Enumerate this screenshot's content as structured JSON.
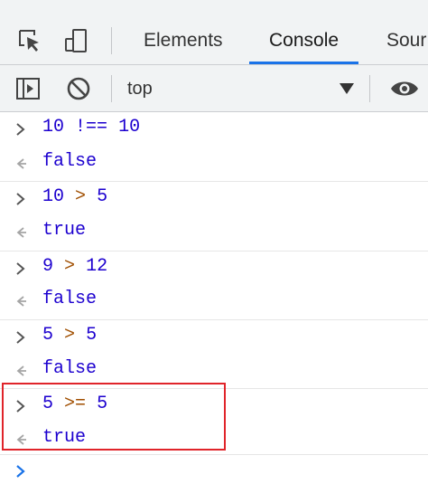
{
  "tabs": [
    {
      "label": "Elements",
      "active": false
    },
    {
      "label": "Console",
      "active": true
    },
    {
      "label": "Sour",
      "active": false
    }
  ],
  "toolbar": {
    "context_label": "top"
  },
  "console": {
    "entries": [
      {
        "input": {
          "left": "10",
          "op": "!==",
          "right": "10"
        },
        "output": "false"
      },
      {
        "input": {
          "left": "10",
          "op": ">",
          "right": "5"
        },
        "output": "true"
      },
      {
        "input": {
          "left": "9",
          "op": ">",
          "right": "12"
        },
        "output": "false"
      },
      {
        "input": {
          "left": "5",
          "op": ">",
          "right": "5"
        },
        "output": "false"
      },
      {
        "input": {
          "left": "5",
          "op": ">=",
          "right": "5"
        },
        "output": "true",
        "highlighted": true
      }
    ]
  },
  "colors": {
    "highlight_border": "#e0242a",
    "active_tab_underline": "#1a73e8",
    "prompt_chevron": "#1a73e8"
  },
  "icons": [
    "inspect-element-icon",
    "device-toolbar-icon",
    "sidebar-toggle-icon",
    "clear-console-icon",
    "dropdown-caret-icon",
    "eye-icon",
    "input-chevron-icon",
    "result-arrow-icon",
    "prompt-chevron-icon"
  ]
}
